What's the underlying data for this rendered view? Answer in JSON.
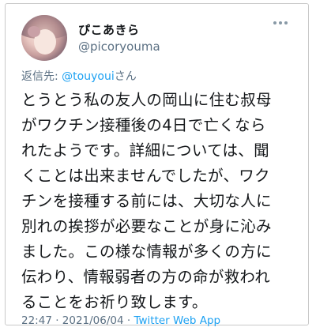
{
  "author": {
    "display_name": "ぴこあきら",
    "handle": "@picoryouma"
  },
  "reply": {
    "prefix": "返信先: ",
    "mention": "@touyoui",
    "suffix": "さん"
  },
  "tweet": {
    "lines": [
      "とうとう私の友人の岡山に住む叔母",
      "がワクチン接種後の4日で亡くなら",
      "れたようです。詳細については、聞",
      "くことは出来ませんでしたが、ワク",
      "チンを接種する前には、大切な人に",
      "別れの挨拶が必要なことが身に沁み",
      "ました。この様な情報が多くの方に",
      "伝わり、情報弱者の方の命が救われ",
      "ることをお祈り致します。"
    ]
  },
  "meta": {
    "time": "22:47",
    "separator1": " · ",
    "date": "2021/06/04",
    "separator2": " · ",
    "source": "Twitter Web App"
  },
  "icons": {
    "more": "more-horizontal-icon",
    "avatar": "avatar"
  }
}
